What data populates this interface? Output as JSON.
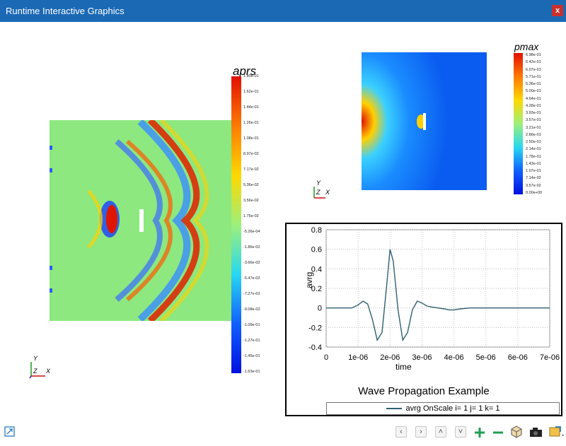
{
  "window": {
    "title": "Runtime Interactive Graphics",
    "close_label": "x"
  },
  "left_view": {
    "colorbar_title": "aprs",
    "colorbar_ticks": [
      "1.80e-01",
      "1.62e-01",
      "1.44e-01",
      "1.26e-01",
      "1.08e-01",
      "8.97e-02",
      "7.17e-02",
      "5.36e-02",
      "3.56e-02",
      "1.75e-02",
      "-5.26e-04",
      "-1.86e-02",
      "-3.66e-02",
      "-5.47e-02",
      "-7.27e-02",
      "-9.08e-02",
      "-1.09e-01",
      "-1.27e-01",
      "-1.45e-01",
      "-1.63e-01"
    ],
    "axes": {
      "y": "Y",
      "z": "Z",
      "x": "X"
    }
  },
  "right_view": {
    "colorbar_title": "pmax",
    "colorbar_ticks": [
      "6.98e-01",
      "6.42e-01",
      "6.07e-01",
      "5.71e-01",
      "5.36e-01",
      "5.00e-01",
      "4.64e-01",
      "4.28e-01",
      "3.93e-01",
      "3.57e-01",
      "3.21e-01",
      "2.86e-01",
      "2.50e-01",
      "2.14e-01",
      "1.78e-01",
      "1.43e-01",
      "1.07e-01",
      "7.14e-02",
      "3.57e-02",
      "0.00e+00"
    ],
    "axes": {
      "y": "Y",
      "z": "Z",
      "x": "X"
    }
  },
  "chart_data": {
    "type": "line",
    "title": "Wave Propagation Example",
    "xlabel": "time",
    "ylabel": "avrg",
    "xlim": [
      0,
      7e-06
    ],
    "ylim": [
      -0.4,
      0.8
    ],
    "x_ticks": [
      "0",
      "1e-06",
      "2e-06",
      "3e-06",
      "4e-06",
      "5e-06",
      "6e-06",
      "7e-06"
    ],
    "y_ticks": [
      "0.8",
      "0.6",
      "0.4",
      "0.2",
      "0",
      "-0.2",
      "-0.4"
    ],
    "grid": true,
    "legend_position": "bottom",
    "series": [
      {
        "name": "avrg OnScale i= 1 j= 1 k= 1",
        "color": "#2f6070",
        "x": [
          0,
          4e-07,
          8e-07,
          1e-06,
          1.15e-06,
          1.3e-06,
          1.45e-06,
          1.6e-06,
          1.75e-06,
          1.9e-06,
          2e-06,
          2.1e-06,
          2.25e-06,
          2.4e-06,
          2.55e-06,
          2.7e-06,
          2.85e-06,
          3e-06,
          3.15e-06,
          3.3e-06,
          3.5e-06,
          3.7e-06,
          3.85e-06,
          4e-06,
          4.2e-06,
          4.5e-06,
          5e-06,
          6e-06,
          7e-06
        ],
        "y": [
          0,
          0,
          0,
          0.03,
          0.07,
          0.04,
          -0.12,
          -0.33,
          -0.25,
          0.25,
          0.6,
          0.48,
          -0.02,
          -0.33,
          -0.25,
          -0.02,
          0.07,
          0.05,
          0.02,
          0.01,
          0,
          -0.01,
          -0.02,
          -0.02,
          -0.01,
          0,
          0,
          0,
          0
        ]
      }
    ]
  },
  "bottom_toolbar": {
    "icons": [
      "expand-icon",
      "chevron-left-icon",
      "chevron-right-icon",
      "chevron-up-icon",
      "chevron-down-icon",
      "zoom-in-icon",
      "zoom-out-icon",
      "cube-icon",
      "camera-icon",
      "export-icon"
    ],
    "labels": {
      "prev": "‹",
      "next": "›",
      "up": "˄",
      "down": "˅"
    }
  }
}
